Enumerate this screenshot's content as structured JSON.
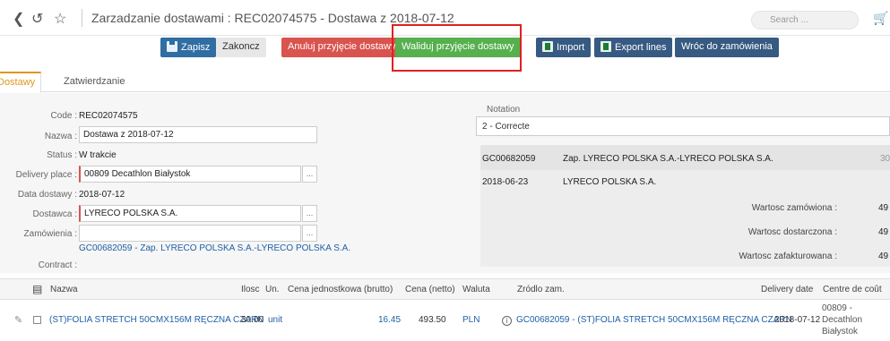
{
  "header": {
    "title": "Zarzadzanie dostawami : REC02074575 - Dostawa z 2018-07-12",
    "search_placeholder": "Search ..."
  },
  "toolbar": {
    "save": "Zapisz",
    "finish": "Zakoncz",
    "cancel_receipt": "Anuluj przyjęcie dostawy",
    "validate_receipt": "Waliduj przyjęcie dostawy",
    "import": "Import",
    "export_lines": "Export lines",
    "back_to_order": "Wróc do zamówienia"
  },
  "tabs": [
    "Dostawy",
    "Zatwierdzanie"
  ],
  "form": {
    "code_label": "Code :",
    "code_value": "REC02074575",
    "name_label": "Nazwa :",
    "name_value": "Dostawa z 2018-07-12",
    "status_label": "Status :",
    "status_value": "W trakcie",
    "delivery_place_label": "Delivery place :",
    "delivery_place_value": "00809 Decathlon Białystok",
    "delivery_date_label": "Data dostawy :",
    "delivery_date_value": "2018-07-12",
    "supplier_label": "Dostawca :",
    "supplier_value": "LYRECO POLSKA S.A.",
    "orders_label": "Zamówienia :",
    "orders_value": "",
    "orders_link": "GC00682059 - Zap. LYRECO POLSKA S.A.-LYRECO POLSKA S.A.",
    "contract_label": "Contract :"
  },
  "notation": {
    "label": "Notation",
    "value": "2 - Correcte"
  },
  "info": {
    "order_code": "GC00682059",
    "order_name": "Zap. LYRECO POLSKA S.A.-LYRECO POLSKA S.A.",
    "order_code_tail": "30",
    "order_date": "2018-06-23",
    "supplier": "LYRECO POLSKA S.A.",
    "ordered_label": "Wartosc zamówiona :",
    "ordered_value": "49",
    "delivered_label": "Wartosc dostarczona :",
    "delivered_value": "49",
    "invoiced_label": "Wartosc zafakturowana :",
    "invoiced_value": "49"
  },
  "table": {
    "headers": {
      "name": "Nazwa",
      "qty": "Ilosc",
      "unit": "Un.",
      "unit_price": "Cena jednostkowa (brutto)",
      "net_price": "Cena (netto)",
      "currency": "Waluta",
      "source": "Zródlo zam.",
      "delivery_date": "Delivery date",
      "cost_centre": "Centre de coût"
    },
    "rows": [
      {
        "name": "(ST)FOLIA STRETCH 50CMX156M RĘCZNA CZARN",
        "qty": "30.00",
        "unit": "unit",
        "unit_price": "16.45",
        "net_price": "493.50",
        "currency": "PLN",
        "source": "GC00682059 - (ST)FOLIA STRETCH 50CMX156M RĘCZNA CZARN",
        "delivery_date": "2018-07-12",
        "cost_centre_1": "00809 -",
        "cost_centre_2": "Decathlon",
        "cost_centre_3": "Białystok"
      }
    ]
  },
  "colors": {
    "primary": "#2f6da3",
    "danger": "#d9534f",
    "success": "#55b04d",
    "dark_blue": "#375a82",
    "tab_active": "#e0961e",
    "highlight": "#e02020"
  }
}
